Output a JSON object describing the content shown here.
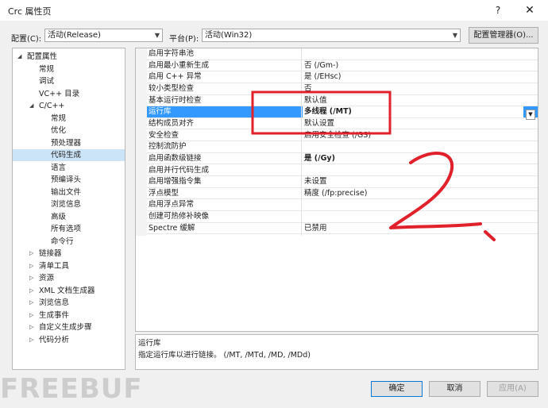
{
  "window": {
    "title": "Crc 属性页",
    "help_glyph": "?",
    "close_glyph": "✕"
  },
  "toolbar": {
    "config_label": "配置(C):",
    "config_value": "活动(Release)",
    "platform_label": "平台(P):",
    "platform_value": "活动(Win32)",
    "config_manager_label": "配置管理器(O)..."
  },
  "tree": {
    "items": [
      {
        "label": "配置属性",
        "level": 0,
        "expander": "◢"
      },
      {
        "label": "常规",
        "level": 1
      },
      {
        "label": "调试",
        "level": 1
      },
      {
        "label": "VC++ 目录",
        "level": 1
      },
      {
        "label": "C/C++",
        "level": 1,
        "expander": "◢"
      },
      {
        "label": "常规",
        "level": 2
      },
      {
        "label": "优化",
        "level": 2
      },
      {
        "label": "预处理器",
        "level": 2
      },
      {
        "label": "代码生成",
        "level": 2,
        "selected": true
      },
      {
        "label": "语言",
        "level": 2
      },
      {
        "label": "预编译头",
        "level": 2
      },
      {
        "label": "输出文件",
        "level": 2
      },
      {
        "label": "浏览信息",
        "level": 2
      },
      {
        "label": "高级",
        "level": 2
      },
      {
        "label": "所有选项",
        "level": 2
      },
      {
        "label": "命令行",
        "level": 2
      },
      {
        "label": "链接器",
        "level": 1,
        "expander": "▷"
      },
      {
        "label": "清单工具",
        "level": 1,
        "expander": "▷"
      },
      {
        "label": "资源",
        "level": 1,
        "expander": "▷"
      },
      {
        "label": "XML 文档生成器",
        "level": 1,
        "expander": "▷"
      },
      {
        "label": "浏览信息",
        "level": 1,
        "expander": "▷"
      },
      {
        "label": "生成事件",
        "level": 1,
        "expander": "▷"
      },
      {
        "label": "自定义生成步骤",
        "level": 1,
        "expander": "▷"
      },
      {
        "label": "代码分析",
        "level": 1,
        "expander": "▷"
      }
    ]
  },
  "grid": {
    "rows": [
      {
        "name": "启用字符串池",
        "value": ""
      },
      {
        "name": "启用最小重新生成",
        "value": "否 (/Gm-)"
      },
      {
        "name": "启用 C++ 异常",
        "value": "是 (/EHsc)"
      },
      {
        "name": "较小类型检查",
        "value": "否"
      },
      {
        "name": "基本运行时检查",
        "value": "默认值"
      },
      {
        "name": "运行库",
        "value": "多线程 (/MT)",
        "selected": true,
        "bold": true
      },
      {
        "name": "结构成员对齐",
        "value": "默认设置"
      },
      {
        "name": "安全检查",
        "value": "启用安全检查 (/GS)"
      },
      {
        "name": "控制流防护",
        "value": ""
      },
      {
        "name": "启用函数级链接",
        "value": "是 (/Gy)",
        "bold": true
      },
      {
        "name": "启用并行代码生成",
        "value": ""
      },
      {
        "name": "启用增强指令集",
        "value": "未设置"
      },
      {
        "name": "浮点模型",
        "value": "精度 (/fp:precise)"
      },
      {
        "name": "启用浮点异常",
        "value": ""
      },
      {
        "name": "创建可热修补映像",
        "value": ""
      },
      {
        "name": "Spectre 缓解",
        "value": "已禁用"
      }
    ],
    "dropdown_glyph": "▼"
  },
  "description": {
    "title": "运行库",
    "text": "指定运行库以进行链接。    (/MT, /MTd, /MD, /MDd)"
  },
  "buttons": {
    "ok": "确定",
    "cancel": "取消",
    "apply": "应用(A)"
  },
  "annotations": {
    "handwritten": "2、",
    "highlight_color": "#e0202a"
  },
  "watermark": "FREEBUF"
}
